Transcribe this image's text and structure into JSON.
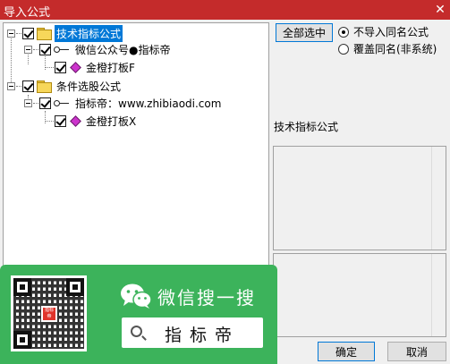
{
  "window": {
    "title": "导入公式",
    "close_label": "✕"
  },
  "tree": {
    "nodes": [
      {
        "label": "技术指标公式",
        "icon": "folder-icon",
        "selected": true
      },
      {
        "label": "微信公众号●指标帝",
        "icon": "key-icon"
      },
      {
        "label": "金橙打板F",
        "icon": "gem-icon"
      },
      {
        "label": "条件选股公式",
        "icon": "folder-icon"
      },
      {
        "label": "指标帝：www.zhibiaodi.com",
        "icon": "key-icon"
      },
      {
        "label": "金橙打板X",
        "icon": "gem-icon"
      }
    ]
  },
  "controls": {
    "select_all_label": "全部选中",
    "radio_options": [
      {
        "label": "不导入同名公式",
        "selected": true
      },
      {
        "label": "覆盖同名(非系统)",
        "selected": false
      }
    ],
    "category_caption": "技术指标公式"
  },
  "buttons": {
    "ok_label": "确定",
    "cancel_label": "取消"
  },
  "promo": {
    "wechat_title": "微信搜一搜",
    "search_text": "指标帝",
    "qr_logo_text": "指标帝",
    "bg_color": "#3cb35b"
  },
  "colors": {
    "titlebar": "#c42b2b",
    "selection": "#0078d7"
  }
}
